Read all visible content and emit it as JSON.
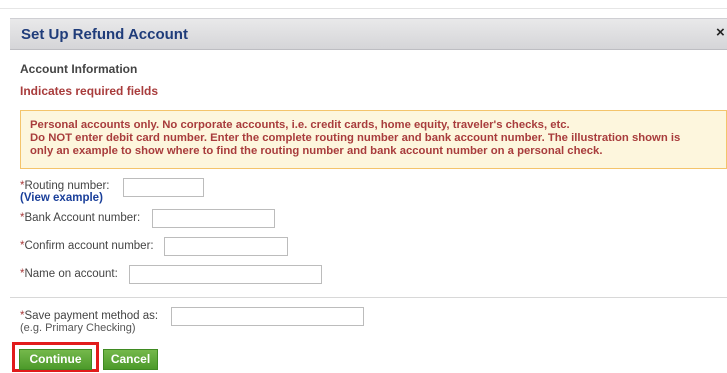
{
  "dialog": {
    "title": "Set Up Refund Account",
    "close_label": "×"
  },
  "section": {
    "title": "Account Information",
    "required_note": "Indicates required fields"
  },
  "warning": {
    "line1": "Personal accounts only. No corporate accounts, i.e. credit cards, home equity, traveler's checks, etc.",
    "line2": "Do NOT enter debit card number. Enter the complete routing number and bank account number. The illustration shown is",
    "line3": "only an example to show where to find the routing number and bank account number on a personal check."
  },
  "form": {
    "required_mark": "*",
    "routing_label": "Routing number:",
    "view_example_open": "(",
    "view_example_link": "View example",
    "view_example_close": ")",
    "routing_value": "",
    "account_label": "Bank Account number:",
    "account_value": "",
    "confirm_label": "Confirm account number:",
    "confirm_value": "",
    "name_label": "Name on account:",
    "name_value": "",
    "save_label": "Save payment method as:",
    "save_hint": "(e.g. Primary Checking)",
    "save_value": ""
  },
  "buttons": {
    "continue_label": "Continue",
    "cancel_label": "Cancel"
  },
  "colors": {
    "header_title": "#1f3c7a",
    "required": "#a83c3c",
    "warning_bg": "#fdf6dd",
    "warning_border": "#f4c46b",
    "button_green": "#4c9a2a",
    "highlight": "#e11b1b"
  }
}
